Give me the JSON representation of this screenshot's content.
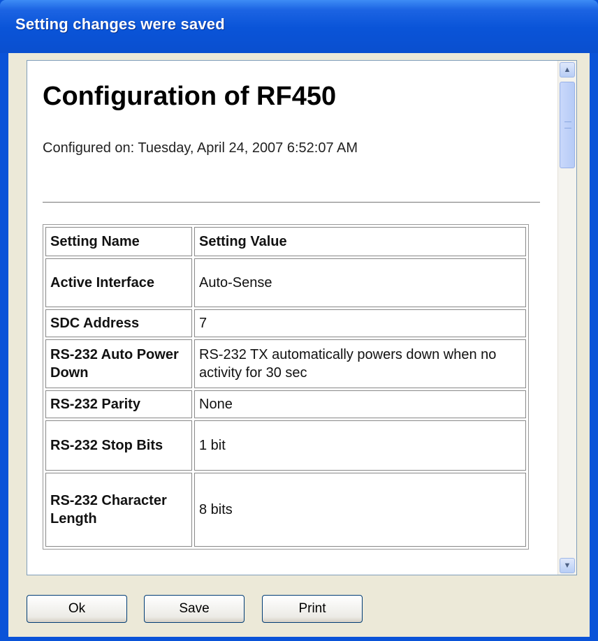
{
  "window": {
    "title": "Setting changes were saved"
  },
  "doc": {
    "heading": "Configuration of RF450",
    "configured_on": "Configured on: Tuesday, April 24, 2007 6:52:07 AM"
  },
  "table": {
    "headers": [
      "Setting Name",
      "Setting Value"
    ],
    "rows": [
      {
        "name": "Active Interface",
        "value": "Auto-Sense"
      },
      {
        "name": "SDC Address",
        "value": "7"
      },
      {
        "name": "RS-232 Auto Power Down",
        "value": "RS-232 TX automatically powers down when no activity for 30 sec"
      },
      {
        "name": "RS-232 Parity",
        "value": "None"
      },
      {
        "name": "RS-232 Stop Bits",
        "value": "1 bit"
      },
      {
        "name": "RS-232 Character Length",
        "value": "8 bits"
      }
    ]
  },
  "buttons": {
    "ok": "Ok",
    "save": "Save",
    "print": "Print"
  },
  "icons": {
    "scroll_up": "arrow-up-icon",
    "scroll_down": "arrow-down-icon"
  }
}
